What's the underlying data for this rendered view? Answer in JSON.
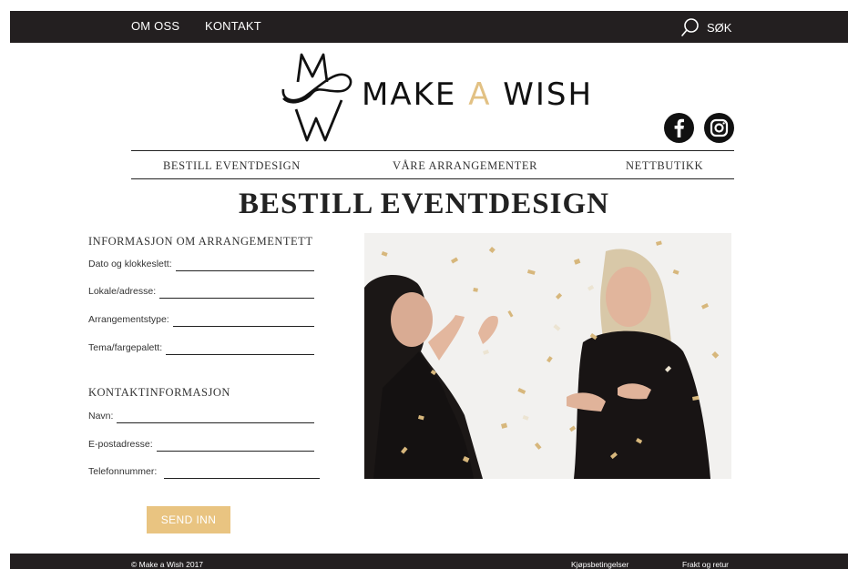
{
  "topbar": {
    "links": [
      "OM OSS",
      "KONTAKT"
    ],
    "search_label": "SØK"
  },
  "logo": {
    "word1": "MAKE",
    "word2": "A",
    "word3": "WISH",
    "accent_color": "#e2c184"
  },
  "social": [
    "facebook-icon",
    "instagram-icon"
  ],
  "main_nav": [
    "BESTILL EVENTDESIGN",
    "VÅRE ARRANGEMENTER",
    "NETTBUTIKK"
  ],
  "page_title": "BESTILL EVENTDESIGN",
  "form": {
    "event_section": {
      "heading": "INFORMASJON OM ARRANGEMENTETT",
      "fields": [
        "Dato og klokkeslett:",
        "Lokale/adresse:",
        "Arrangementstype:",
        "Tema/fargepalett:"
      ]
    },
    "contact_section": {
      "heading": "KONTAKTINFORMASJON",
      "fields": [
        "Navn:",
        "E-postadresse:",
        "Telefonnummer:"
      ]
    },
    "submit_label": "SEND INN",
    "submit_color": "#e9c481"
  },
  "photo": {
    "subject": "two-women-with-confetti"
  },
  "footer": {
    "copyright": "© Make a Wish 2017",
    "links": [
      "Kjøpsbetingelser",
      "Frakt og retur"
    ]
  },
  "colors": {
    "bar": "#231f20",
    "accent": "#e2c184"
  }
}
